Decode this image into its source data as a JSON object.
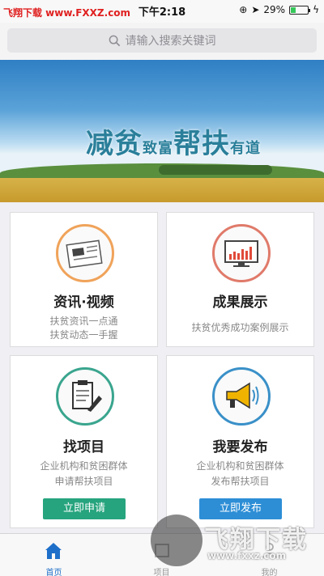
{
  "status_bar": {
    "carrier": "飞翔下载 www.FXXZ.com",
    "time": "下午2:18",
    "battery": "29%",
    "battery_level": 0.29
  },
  "search": {
    "placeholder": "请输入搜索关键词"
  },
  "banner": {
    "slogan_1": "减贫",
    "slogan_2": "致富",
    "slogan_3": "帮扶",
    "slogan_4": "有道"
  },
  "cards": [
    {
      "title": "资讯·视频",
      "desc_1": "扶贫资讯一点通",
      "desc_2": "扶贫动态一手握",
      "icon": "newspaper-icon"
    },
    {
      "title": "成果展示",
      "desc_1": "扶贫优秀成功案例展示",
      "icon": "monitor-chart-icon"
    },
    {
      "title": "找项目",
      "desc_1": "企业机构和贫困群体",
      "desc_2": "申请帮扶项目",
      "button": "立即申请",
      "icon": "clipboard-pen-icon"
    },
    {
      "title": "我要发布",
      "desc_1": "企业机构和贫困群体",
      "desc_2": "发布帮扶项目",
      "button": "立即发布",
      "icon": "megaphone-icon"
    }
  ],
  "tabbar": {
    "items": [
      {
        "label": "首页",
        "icon": "home-icon",
        "active": true
      },
      {
        "label": "项目",
        "icon": "project-icon"
      },
      {
        "label": "我的",
        "icon": "user-icon"
      }
    ]
  },
  "watermark": {
    "text": "飞翔下载",
    "url": "www.fxxz.com"
  },
  "colors": {
    "accent": "#1e6fc9",
    "button": "#26a47d",
    "orange_ring": "#f0a35a"
  }
}
